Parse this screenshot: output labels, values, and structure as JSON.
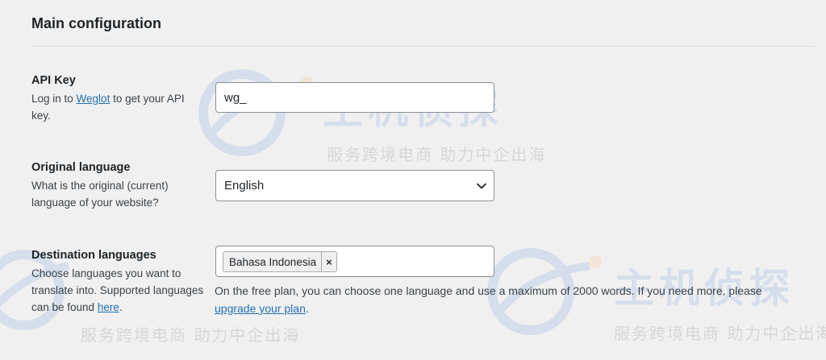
{
  "section": {
    "title": "Main configuration"
  },
  "api_key": {
    "title": "API Key",
    "desc_prefix": "Log in to ",
    "desc_link": "Weglot",
    "desc_suffix": " to get your API key.",
    "input_value": "wg_"
  },
  "original_language": {
    "title": "Original language",
    "desc": "What is the original (current) language of your website?",
    "selected": "English"
  },
  "destination_languages": {
    "title": "Destination languages",
    "desc_prefix": "Choose languages you want to translate into. Supported languages can be found ",
    "desc_link": "here",
    "desc_suffix": ".",
    "chips": [
      "Bahasa Indonesia"
    ],
    "chip_remove": "×",
    "help_prefix": "On the free plan, you can choose one language and use a maximum of 2000 words. If you need more, please ",
    "help_link": "upgrade your plan",
    "help_suffix": "."
  },
  "watermark": {
    "main_text": "主机侦探",
    "sub_text": "服务跨境电商 助力中企出海"
  },
  "colors": {
    "background": "#f0f0f1",
    "link": "#2271b1",
    "border": "#8c8f94"
  }
}
